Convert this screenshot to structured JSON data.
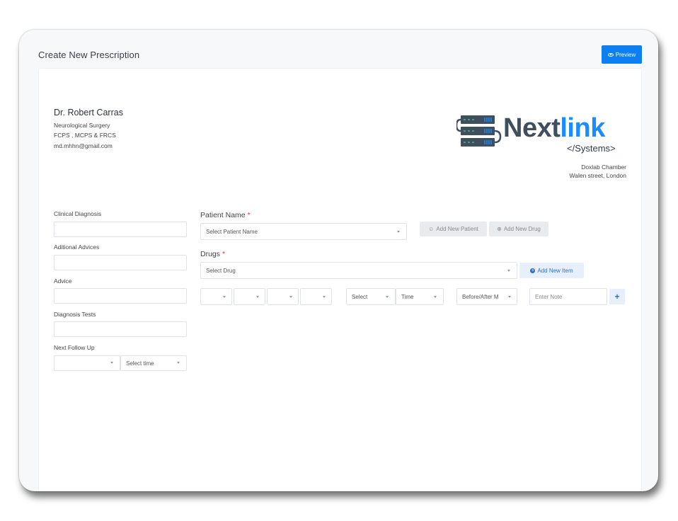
{
  "header": {
    "title": "Create New Prescription",
    "preview_label": "Preview"
  },
  "doctor": {
    "name": "Dr. Robert Carras",
    "specialty": "Neurological Surgery",
    "qualifications": "FCPS , MCPS  & FRCS",
    "email": "md.mhhn@gmail.com"
  },
  "clinic": {
    "logo_main": "Next",
    "logo_accent": "link",
    "logo_sub": "</Systems>",
    "address_line1": "Doxlab Chamber",
    "address_line2": "Walen street, London"
  },
  "left_form": {
    "clinical_diagnosis_label": "Clinical Diagnosis",
    "clinical_diagnosis_value": "",
    "additional_advices_label": "Aditional Advices",
    "additional_advices_value": "",
    "advice_label": "Advice",
    "advice_value": "",
    "diagnosis_tests_label": "Diagnosis Tests",
    "diagnosis_tests_value": "",
    "next_follow_up_label": "Next Follow Up",
    "follow_up_date_value": "",
    "follow_up_time_placeholder": "Select time"
  },
  "patient": {
    "label": "Patient Name",
    "required_mark": "*",
    "select_placeholder": "Select Patient Name",
    "add_patient_label": "Add New Patient",
    "add_drug_label": "Add New Drug"
  },
  "drugs": {
    "label": "Drugs",
    "required_mark": "*",
    "select_placeholder": "Select Drug",
    "add_item_label": "Add New Item",
    "dose_selects": [
      "",
      "",
      "",
      ""
    ],
    "period_select": "Select",
    "time_select": "Time",
    "meal_select": "Before/After M",
    "note_placeholder": "Enter Note",
    "add_row_label": "+"
  },
  "colors": {
    "accent": "#0d7ff1",
    "logo_blue": "#1a8cff",
    "logo_dark": "#3f4f5d",
    "required": "#e53935"
  },
  "icons": {
    "preview": "eye-icon",
    "add_patient": "user-add-icon",
    "add_drug": "plus-circle-outline-icon",
    "add_item": "plus-circle-icon",
    "logo": "server-stack-icon"
  }
}
